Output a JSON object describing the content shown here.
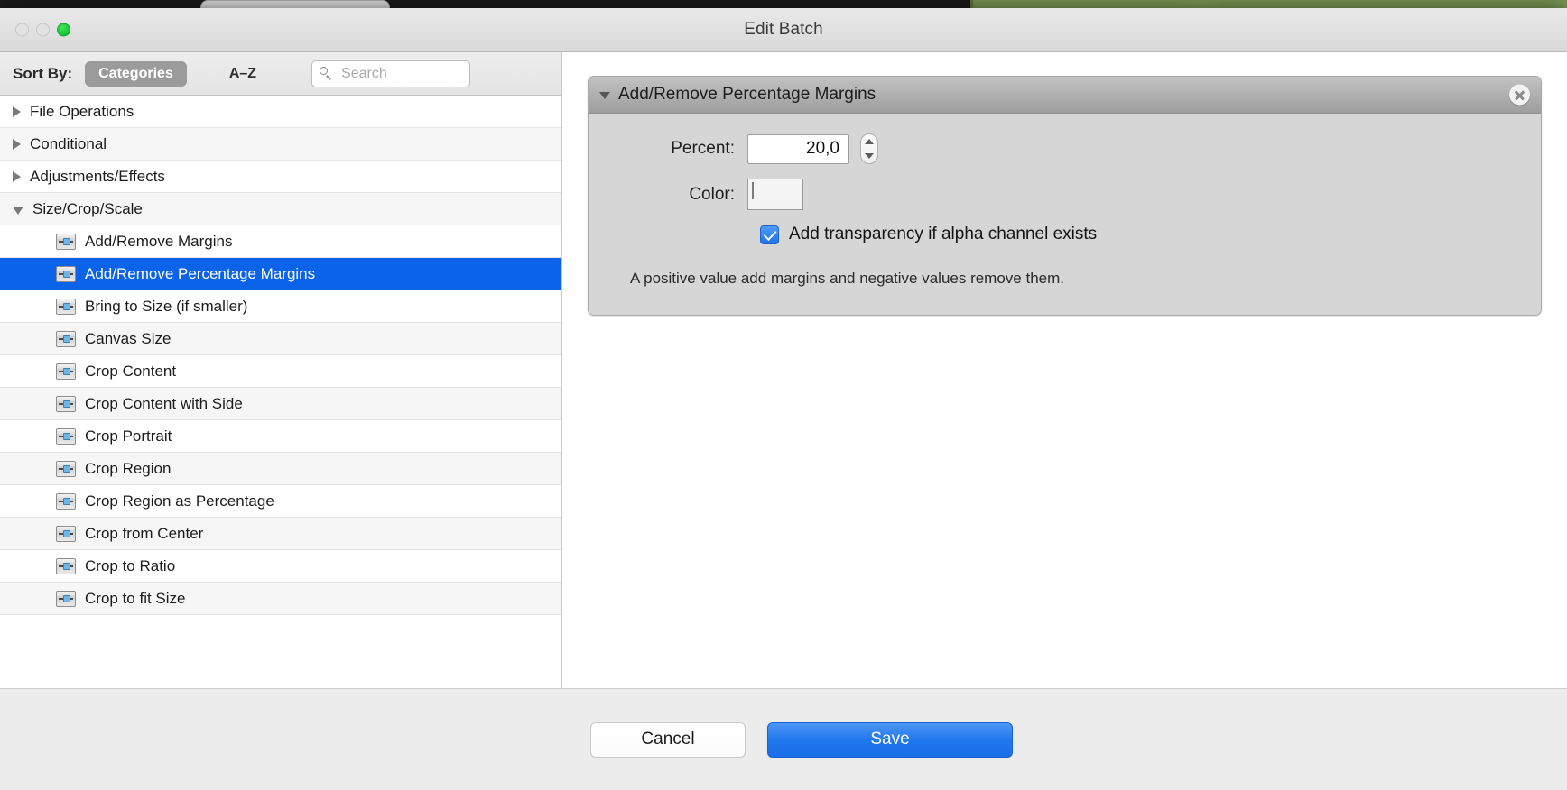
{
  "window": {
    "title": "Edit Batch",
    "traffic_lights": [
      "close",
      "minimize",
      "maximize"
    ]
  },
  "sidebar": {
    "sort_by_label": "Sort By:",
    "sort_options": [
      {
        "label": "Categories",
        "selected": true
      },
      {
        "label": "A–Z",
        "selected": false
      }
    ],
    "search": {
      "placeholder": "Search",
      "value": ""
    },
    "rows": [
      {
        "label": "File Operations",
        "type": "group",
        "expanded": false
      },
      {
        "label": "Conditional",
        "type": "group",
        "expanded": false
      },
      {
        "label": "Adjustments/Effects",
        "type": "group",
        "expanded": false
      },
      {
        "label": "Size/Crop/Scale",
        "type": "group",
        "expanded": true
      },
      {
        "label": "Add/Remove Margins",
        "type": "item",
        "selected": false
      },
      {
        "label": "Add/Remove Percentage Margins",
        "type": "item",
        "selected": true
      },
      {
        "label": "Bring to Size (if smaller)",
        "type": "item",
        "selected": false
      },
      {
        "label": "Canvas Size",
        "type": "item",
        "selected": false
      },
      {
        "label": "Crop Content",
        "type": "item",
        "selected": false
      },
      {
        "label": "Crop Content with Side",
        "type": "item",
        "selected": false
      },
      {
        "label": "Crop Portrait",
        "type": "item",
        "selected": false
      },
      {
        "label": "Crop Region",
        "type": "item",
        "selected": false
      },
      {
        "label": "Crop Region as Percentage",
        "type": "item",
        "selected": false
      },
      {
        "label": "Crop from Center",
        "type": "item",
        "selected": false
      },
      {
        "label": "Crop to Ratio",
        "type": "item",
        "selected": false
      },
      {
        "label": "Crop to fit Size",
        "type": "item",
        "selected": false
      }
    ]
  },
  "panel": {
    "title": "Add/Remove Percentage Margins",
    "expanded": true,
    "close_label": "✕",
    "percent": {
      "label": "Percent:",
      "value": "20,0"
    },
    "color": {
      "label": "Color:",
      "value": "#d93c8c"
    },
    "transparency_checkbox": {
      "label": "Add transparency if alpha channel exists",
      "checked": true
    },
    "hint": "A positive value add margins and negative values remove them."
  },
  "footer": {
    "cancel_label": "Cancel",
    "save_label": "Save"
  },
  "colors": {
    "selection_blue": "#0a63e8",
    "accent_blue": "#2077ef",
    "swatch_pink": "#d93c8c",
    "segment_selected": "#9b9b9b"
  }
}
